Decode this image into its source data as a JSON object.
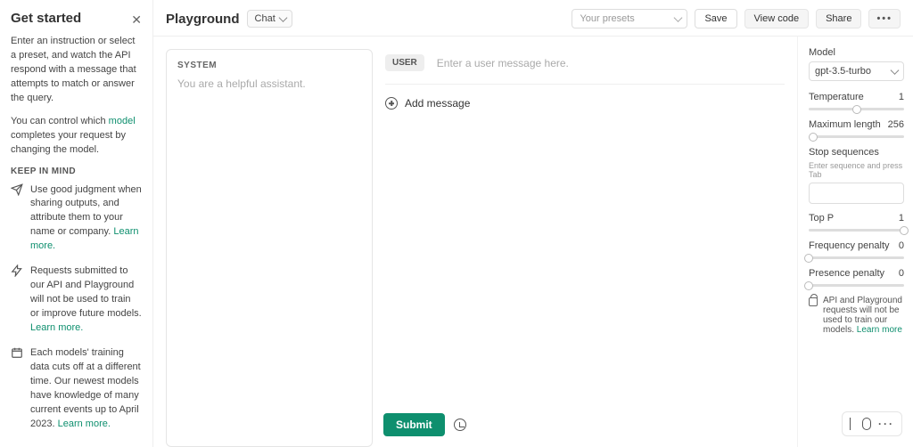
{
  "sidebar": {
    "title": "Get started",
    "intro": "Enter an instruction or select a preset, and watch the API respond with a message that attempts to match or answer the query.",
    "control_pre": "You can control which ",
    "control_link": "model",
    "control_post": " completes your request by changing the model.",
    "keep": "KEEP IN MIND",
    "tips": [
      {
        "text": "Use good judgment when sharing outputs, and attribute them to your name or company. ",
        "link": "Learn more."
      },
      {
        "text": "Requests submitted to our API and Playground will not be used to train or improve future models. ",
        "link": "Learn more."
      },
      {
        "text": "Each models' training data cuts off at a different time. Our newest models have knowledge of many current events up to April 2023. ",
        "link": "Learn more."
      }
    ]
  },
  "header": {
    "title": "Playground",
    "mode": "Chat",
    "presets_placeholder": "Your presets",
    "save": "Save",
    "view_code": "View code",
    "share": "Share"
  },
  "system": {
    "label": "SYSTEM",
    "placeholder": "You are a helpful assistant."
  },
  "chat": {
    "role": "USER",
    "placeholder": "Enter a user message here.",
    "add": "Add message"
  },
  "footer": {
    "submit": "Submit"
  },
  "params": {
    "model_label": "Model",
    "model_value": "gpt-3.5-turbo",
    "temperature_label": "Temperature",
    "temperature_value": "1",
    "maxlen_label": "Maximum length",
    "maxlen_value": "256",
    "stop_label": "Stop sequences",
    "stop_hint": "Enter sequence and press Tab",
    "topp_label": "Top P",
    "topp_value": "1",
    "freq_label": "Frequency penalty",
    "freq_value": "0",
    "pres_label": "Presence penalty",
    "pres_value": "0",
    "note_pre": "API and Playground requests will not be used to train our models. ",
    "note_link": "Learn more"
  }
}
